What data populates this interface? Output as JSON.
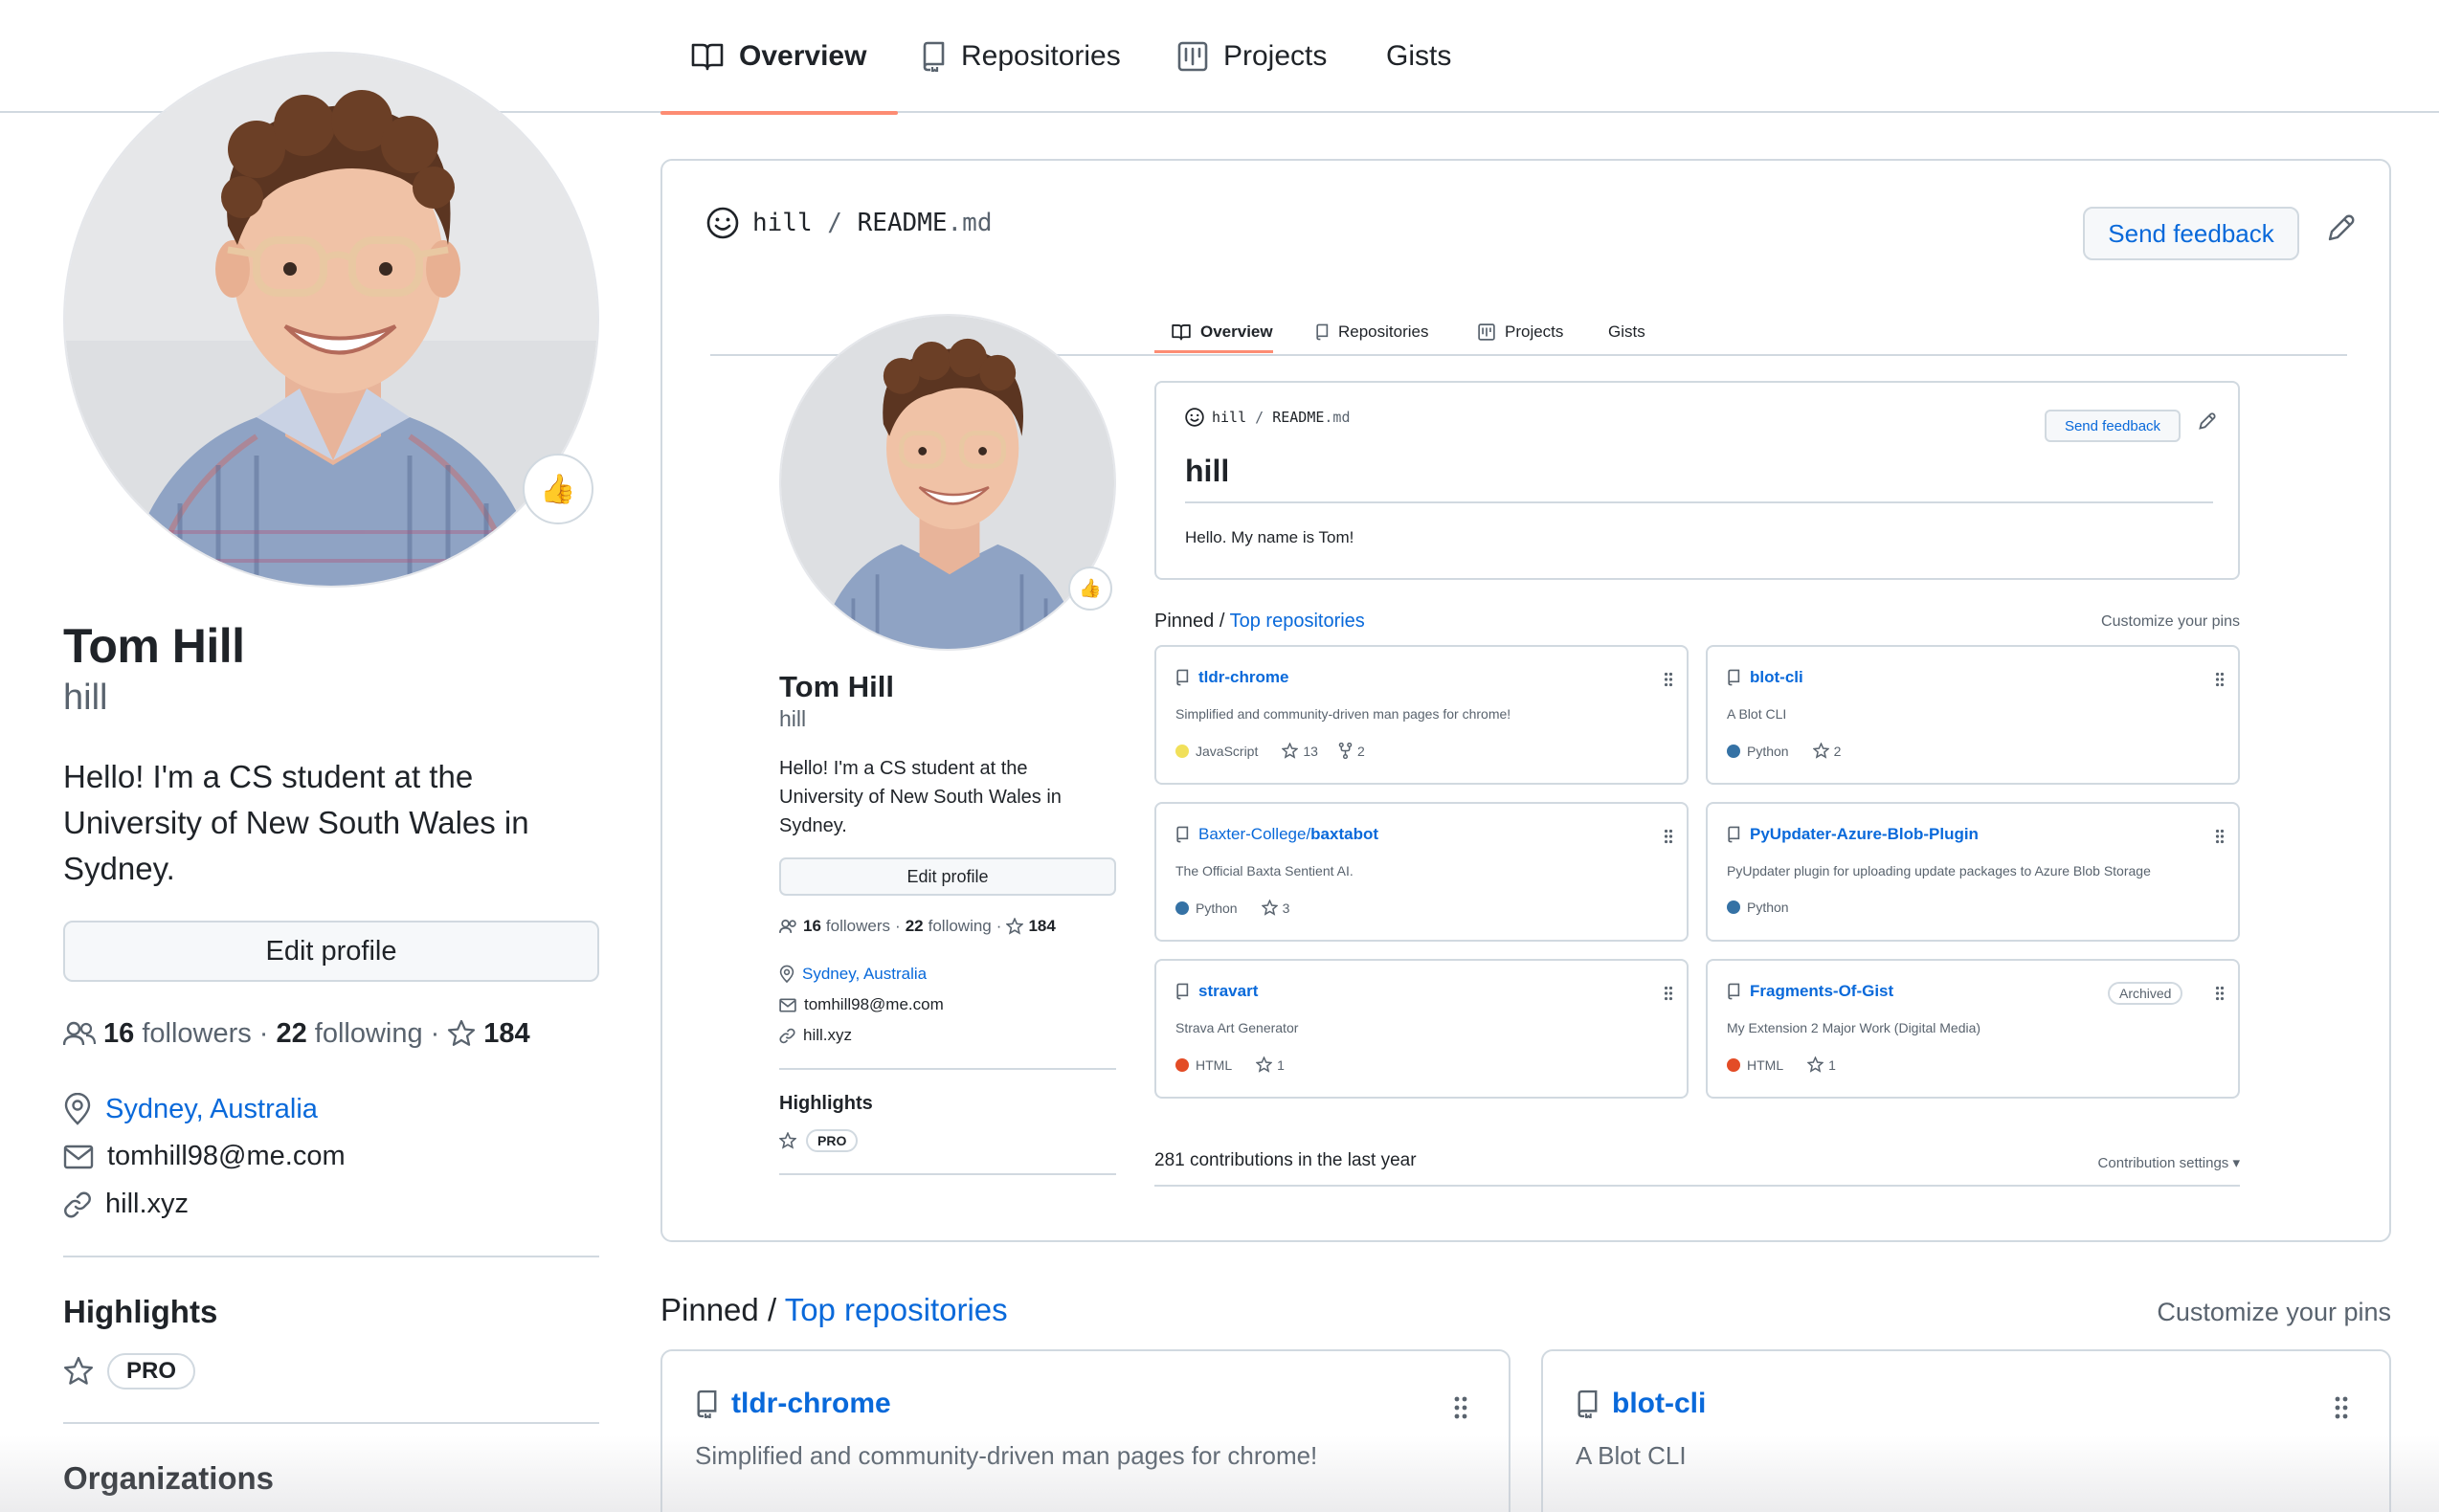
{
  "nav": {
    "tabs": [
      {
        "label": "Overview",
        "icon": "book-icon",
        "active": true
      },
      {
        "label": "Repositories",
        "icon": "repo-icon"
      },
      {
        "label": "Projects",
        "icon": "project-icon"
      },
      {
        "label": "Gists",
        "icon": ""
      }
    ]
  },
  "profile": {
    "name": "Tom Hill",
    "username": "hill",
    "bio": "Hello! I'm a CS student at the University of New South Wales in Sydney.",
    "bio_lines": [
      "Hello! I'm a CS student at the",
      "University of New South Wales in",
      "Sydney."
    ],
    "status_emoji": "👍",
    "edit_label": "Edit profile",
    "followers_count": "16",
    "followers_label": "followers",
    "following_count": "22",
    "following_label": "following",
    "dot": "·",
    "stars": "184",
    "location": "Sydney, Australia",
    "email": "tomhill98@me.com",
    "website": "hill.xyz",
    "highlights_title": "Highlights",
    "pro_label": "PRO",
    "organizations_title": "Organizations"
  },
  "readme": {
    "path_user": "hill",
    "path_sep": "/",
    "path_file": "README",
    "path_ext": ".md",
    "feedback_label": "Send feedback",
    "inner": {
      "tabs": [
        "Overview",
        "Repositories",
        "Projects",
        "Gists"
      ],
      "name": "Tom Hill",
      "username": "hill",
      "bio_lines": [
        "Hello! I'm a CS student at the",
        "University of New South Wales in",
        "Sydney."
      ],
      "edit_label": "Edit profile",
      "followers_count": "16",
      "followers_label": "followers",
      "following_count": "22",
      "following_label": "following",
      "stars": "184",
      "location": "Sydney, Australia",
      "email": "tomhill98@me.com",
      "website": "hill.xyz",
      "highlights_title": "Highlights",
      "pro_label": "PRO",
      "readme_user": "hill",
      "readme_file": "README",
      "readme_ext": ".md",
      "feedback_label": "Send feedback",
      "heading": "hill",
      "body": "Hello. My name is Tom!",
      "pinned_label": "Pinned",
      "pinned_sep": "/",
      "top_repos_label": "Top repositories",
      "customize_label": "Customize your pins",
      "repos": [
        {
          "name": "tldr-chrome",
          "desc": "Simplified and community-driven man pages for chrome!",
          "lang": "JavaScript",
          "lang_color": "#f1e05a",
          "stars": "13",
          "forks": "2",
          "badge": ""
        },
        {
          "name": "blot-cli",
          "desc": "A Blot CLI",
          "lang": "Python",
          "lang_color": "#3572A5",
          "stars": "2",
          "forks": "",
          "badge": ""
        },
        {
          "owner": "Baxter-College/",
          "name": "baxtabot",
          "desc": "The Official Baxta Sentient AI.",
          "lang": "Python",
          "lang_color": "#3572A5",
          "stars": "3",
          "forks": "",
          "badge": ""
        },
        {
          "name": "PyUpdater-Azure-Blob-Plugin",
          "desc": "PyUpdater plugin for uploading update packages to Azure Blob Storage",
          "lang": "Python",
          "lang_color": "#3572A5",
          "stars": "",
          "forks": "",
          "badge": ""
        },
        {
          "name": "stravart",
          "desc": "Strava Art Generator",
          "lang": "HTML",
          "lang_color": "#e34c26",
          "stars": "1",
          "forks": "",
          "badge": ""
        },
        {
          "name": "Fragments-Of-Gist",
          "desc": "My Extension 2 Major Work (Digital Media)",
          "lang": "HTML",
          "lang_color": "#e34c26",
          "stars": "1",
          "forks": "",
          "badge": "Archived"
        }
      ],
      "contrib_label": "281 contributions in the last year",
      "contrib_settings": "Contribution settings ▾"
    }
  },
  "pinned": {
    "label": "Pinned",
    "sep": "/",
    "top_label": "Top repositories",
    "customize_label": "Customize your pins",
    "repos": [
      {
        "name": "tldr-chrome",
        "desc": "Simplified and community-driven man pages for chrome!"
      },
      {
        "name": "blot-cli",
        "desc": "A Blot CLI"
      }
    ]
  }
}
